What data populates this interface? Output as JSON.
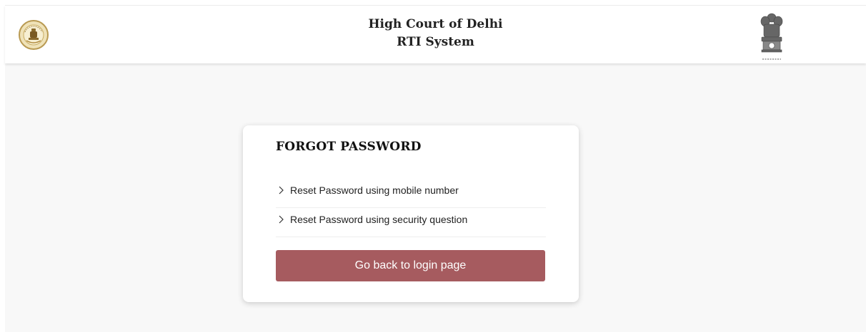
{
  "header": {
    "title_line1": "High Court of Delhi",
    "title_line2": "RTI System",
    "left_logo_icon": "high-court-seal-icon",
    "right_logo_icon": "national-emblem-icon"
  },
  "forgot_password": {
    "title": "FORGOT PASSWORD",
    "options": [
      {
        "label": "Reset Password using mobile number",
        "icon": "chevron-right-icon"
      },
      {
        "label": "Reset Password using security question",
        "icon": "chevron-right-icon"
      }
    ],
    "back_button_label": "Go back to login page"
  },
  "colors": {
    "primary_button": "#a65b5f",
    "background": "#f8f8f8",
    "card": "#ffffff"
  }
}
